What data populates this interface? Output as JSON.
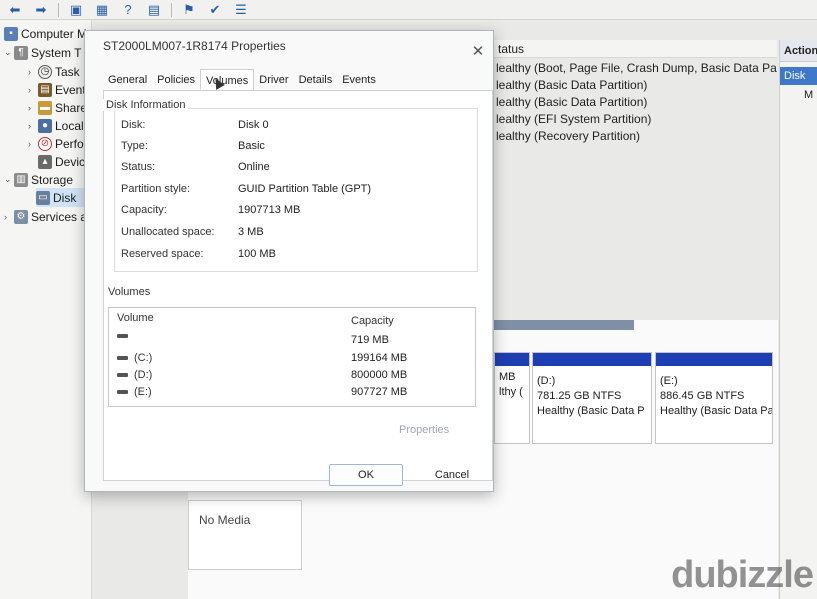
{
  "toolbar": {
    "buttons": [
      {
        "icon": "back-arrow-icon",
        "glyph": "⬅"
      },
      {
        "icon": "forward-arrow-icon",
        "glyph": "➡"
      },
      {
        "icon": "folder-up-icon",
        "glyph": "▣"
      },
      {
        "icon": "grid-view-icon",
        "glyph": "▦"
      },
      {
        "icon": "help-icon",
        "glyph": "?"
      },
      {
        "icon": "list-view-icon",
        "glyph": "▤"
      },
      {
        "icon": "flag-icon",
        "glyph": "⚑"
      },
      {
        "icon": "check-icon",
        "glyph": "✔"
      },
      {
        "icon": "properties-icon",
        "glyph": "☰"
      }
    ]
  },
  "tree": {
    "items": [
      {
        "label": "Computer M",
        "icon": "computer-icon",
        "twisty": ""
      },
      {
        "label": "System T",
        "icon": "tools-icon",
        "twisty": "⌄"
      },
      {
        "label": "Task",
        "icon": "clock-icon",
        "twisty": "›"
      },
      {
        "label": "Event",
        "icon": "event-viewer-icon",
        "twisty": "›"
      },
      {
        "label": "Share",
        "icon": "shared-folder-icon",
        "twisty": "›"
      },
      {
        "label": "Local",
        "icon": "users-icon",
        "twisty": "›"
      },
      {
        "label": "Perfo",
        "icon": "performance-icon",
        "twisty": "›"
      },
      {
        "label": "Devic",
        "icon": "device-manager-icon",
        "twisty": ""
      },
      {
        "label": "Storage",
        "icon": "storage-icon",
        "twisty": "⌄"
      },
      {
        "label": "Disk",
        "icon": "disk-icon",
        "twisty": ""
      },
      {
        "label": "Services a",
        "icon": "services-icon",
        "twisty": "›"
      }
    ]
  },
  "status_column": {
    "header": "tatus",
    "rows": [
      "lealthy (Boot, Page File, Crash Dump, Basic Data Partition",
      "lealthy (Basic Data Partition)",
      "lealthy (Basic Data Partition)",
      "lealthy (EFI System Partition)",
      "lealthy (Recovery Partition)"
    ]
  },
  "actions": {
    "title": "Actions",
    "item": "Disk M",
    "more": "M"
  },
  "graphical": {
    "partitions": [
      {
        "name": "",
        "size": "MB",
        "status": "lthy ("
      },
      {
        "name": "(D:)",
        "size": "781.25 GB NTFS",
        "status": "Healthy (Basic Data P"
      },
      {
        "name": "(E:)",
        "size": "886.45 GB NTFS",
        "status": "Healthy (Basic Data Pa"
      }
    ],
    "cdrom": "No Media"
  },
  "dialog": {
    "title": "ST2000LM007-1R8174 Properties",
    "close_glyph": "✕",
    "tabs": [
      "General",
      "Policies",
      "Volumes",
      "Driver",
      "Details",
      "Events"
    ],
    "active_tab": "Volumes",
    "disk_info": {
      "group_title": "Disk Information",
      "rows": [
        {
          "label": "Disk:",
          "value": "Disk 0"
        },
        {
          "label": "Type:",
          "value": "Basic"
        },
        {
          "label": "Status:",
          "value": "Online"
        },
        {
          "label": "Partition style:",
          "value": "GUID Partition Table (GPT)"
        },
        {
          "label": "Capacity:",
          "value": "1907713 MB"
        },
        {
          "label": "Unallocated space:",
          "value": "3 MB"
        },
        {
          "label": "Reserved space:",
          "value": "100 MB"
        }
      ]
    },
    "volumes": {
      "title": "Volumes",
      "col_volume": "Volume",
      "col_capacity": "Capacity",
      "rows": [
        {
          "volume": "",
          "capacity": "719 MB"
        },
        {
          "volume": "(C:)",
          "capacity": "199164 MB"
        },
        {
          "volume": "(D:)",
          "capacity": "800000 MB"
        },
        {
          "volume": "(E:)",
          "capacity": "907727 MB"
        }
      ]
    },
    "properties_link": "Properties",
    "ok_label": "OK",
    "cancel_label": "Cancel"
  },
  "watermark": "dubizzle"
}
